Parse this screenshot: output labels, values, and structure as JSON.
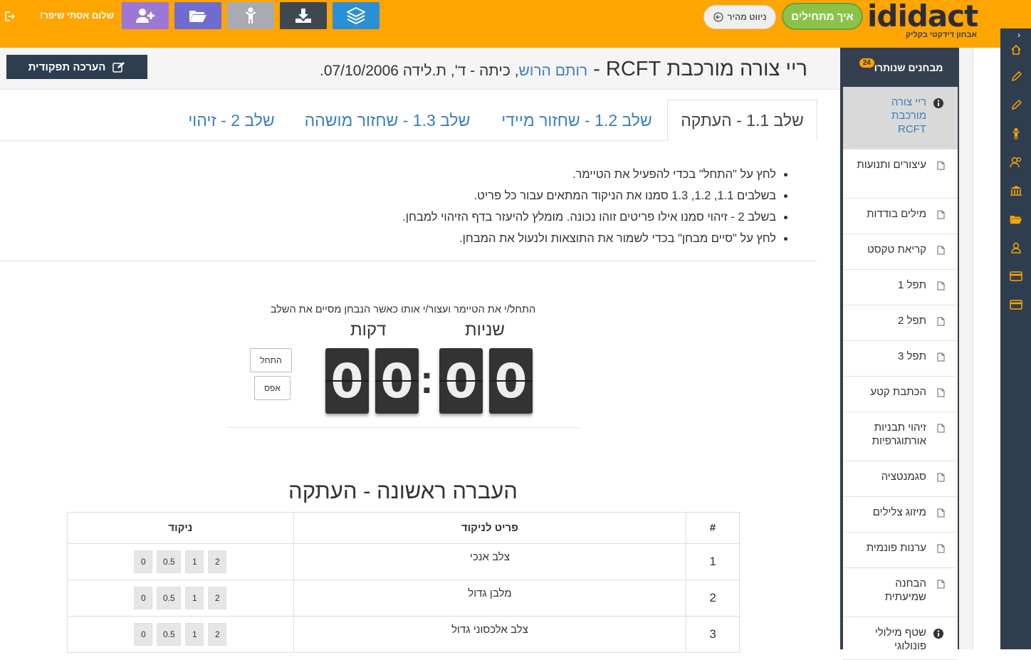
{
  "topbar": {
    "logo_word": "ididact",
    "logo_tagline": "אבחון דידקטי בקליק",
    "start_label": "איך מתחילים",
    "quick_nav_label": "ניווט מהיר",
    "greeting": "שלום אסתי שיפר!",
    "accent": "#FFA500",
    "buttons": [
      {
        "name": "layers-button",
        "icon": "layers-icon",
        "color": "#2b8fd6"
      },
      {
        "name": "download-button",
        "icon": "download-icon",
        "color": "#3d4852"
      },
      {
        "name": "child-button",
        "icon": "child-icon",
        "color": "#a8acb2"
      },
      {
        "name": "folder-button",
        "icon": "folder-open-icon",
        "color": "#6f6cd1"
      },
      {
        "name": "add-user-button",
        "icon": "user-plus-icon",
        "color": "#9b77d6"
      }
    ]
  },
  "header": {
    "test_name": "ריי צורה מורכבת RCFT",
    "separator": " - ",
    "student_name": "רותם הרוש",
    "student_details": ", כיתה - ד', ת.לידה 07/10/2006.",
    "eval_button": "הערכה תפקודית"
  },
  "tabs": [
    {
      "label": "שלב 1.1 - העתקה",
      "active": true
    },
    {
      "label": "שלב 1.2 - שחזור מיידי",
      "active": false
    },
    {
      "label": "שלב 1.3 - שחזור מושהה",
      "active": false
    },
    {
      "label": "שלב 2 - זיהוי",
      "active": false
    }
  ],
  "instructions": [
    "לחץ על \"התחל\" בכדי להפעיל את הטיימר.",
    "בשלבים 1.1, 1.2, 1.3 סמנו את הניקוד המתאים עבור כל פריט.",
    "בשלב 2 - זיהוי סמנו אילו פריטים זוהו נכונה. מומלץ להיעזר בדף הזיהוי למבחן.",
    "לחץ על \"סיים מבחן\" בכדי לשמור את התוצאות ולנעול את המבחן."
  ],
  "timer": {
    "caption": "התחל/י את הטיימר ועצור/י אותו כאשר הנבחן מסיים את השלב",
    "minutes_label": "דקות",
    "seconds_label": "שניות",
    "digits": [
      "0",
      "0",
      "0",
      "0"
    ],
    "colon": ":",
    "start_label": "התחל",
    "reset_label": "אפס"
  },
  "section": {
    "title": "העברה ראשונה - העתקה",
    "columns": {
      "num": "#",
      "item": "פריט לניקוד",
      "score": "ניקוד"
    },
    "score_options": [
      "0",
      "0.5",
      "1",
      "2"
    ],
    "rows": [
      {
        "num": "1",
        "item": "צלב אנכי"
      },
      {
        "num": "2",
        "item": "מלבן גדול"
      },
      {
        "num": "3",
        "item": "צלב אלכסוני גדול"
      }
    ]
  },
  "sidebar": {
    "title": "מבחנים שנותרו",
    "badge": "24",
    "items": [
      {
        "label": "ריי צורה מורכבת RCFT",
        "icon": "info-icon",
        "active": true
      },
      {
        "label": "עיצורים ותנועות",
        "icon": "file-icon"
      },
      {
        "label": "מילים בודדות",
        "icon": "file-icon"
      },
      {
        "label": "קריאת טקסט",
        "icon": "file-icon"
      },
      {
        "label": "תפל 1",
        "icon": "file-icon"
      },
      {
        "label": "תפל 2",
        "icon": "file-icon"
      },
      {
        "label": "תפל 3",
        "icon": "file-icon"
      },
      {
        "label": "הכתבת קטע",
        "icon": "file-icon"
      },
      {
        "label": "זיהוי תבניות אורתוגרפיות",
        "icon": "file-icon"
      },
      {
        "label": "סגמנטציה",
        "icon": "file-icon"
      },
      {
        "label": "מיזוג צלילים",
        "icon": "file-icon"
      },
      {
        "label": "ערנות פונמית",
        "icon": "file-icon"
      },
      {
        "label": "הבחנה שמיעתית",
        "icon": "file-icon"
      },
      {
        "label": "שטף מילולי פונולוגי",
        "icon": "info-icon"
      }
    ]
  },
  "rail_icons": [
    "home-icon",
    "pencil-icon",
    "pencil-icon",
    "child-icon",
    "users-icon",
    "bank-icon",
    "folder-open-icon",
    "user-icon",
    "credit-card-icon",
    "credit-card-icon"
  ]
}
